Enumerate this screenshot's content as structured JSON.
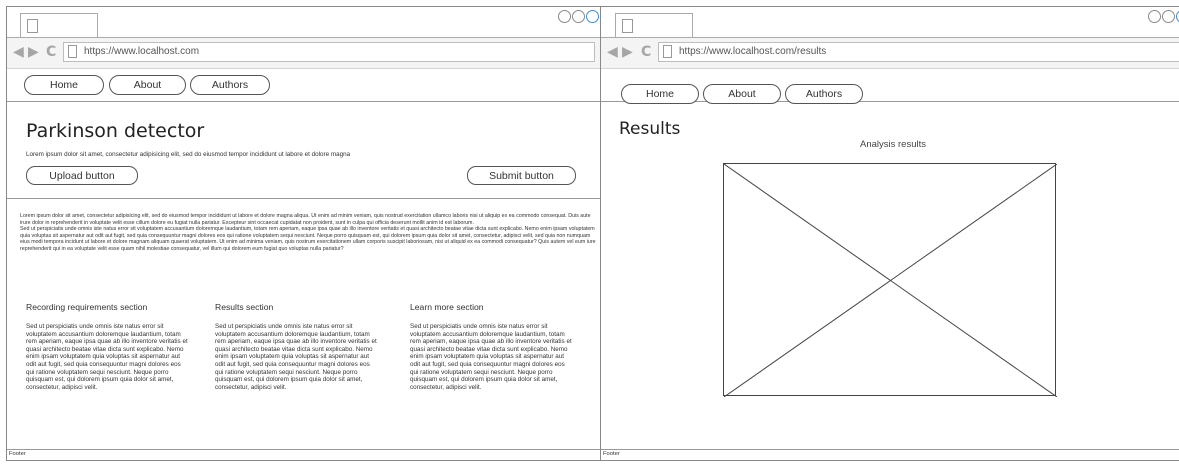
{
  "left_window": {
    "url": "https://www.localhost.com",
    "nav": {
      "home": "Home",
      "about": "About",
      "authors": "Authors"
    },
    "hero": {
      "title": "Parkinson detector",
      "description": "Lorem ipsum dolor sit amet, consectetur adipisicing elit, sed do eiusmod tempor incididunt ut labore et dolore magna",
      "upload_button": "Upload button",
      "submit_button": "Submit button"
    },
    "paragraph": {
      "part1": "Lorem ipsum dolor sit amet, consectetur adipisicing elit, sed do eiusmod tempor incididunt ut labore et dolore magna aliqua. Ut enim ad minim veniam, quis nostrud exercitation ullamco laboris nisi ut aliquip ex ea commodo consequat. Duis aute irure dolor in reprehenderit in voluptate velit esse cillum dolore eu fugiat nulla pariatur. Excepteur sint occaecat cupidatat non proident, sunt in culpa qui officia deserunt mollit anim id est laborum.",
      "part2": "Sed ut perspiciatis unde omnis iste natus error sit voluptatem accusantium doloremque laudantium, totam rem aperiam, eaque ipsa quae ab illo inventore veritatis et quasi architecto beatae vitae dicta sunt explicabo. Nemo enim ipsam voluptatem quia voluptas sit aspernatur aut odit aut fugit, sed quia consequuntur magni dolores eos qui ratione voluptatem sequi nesciunt. Neque porro quisquam est, qui dolorem ipsum quia dolor sit amet, consectetur, adipisci velit, sed quia non numquam eius modi tempora incidunt ut labore et dolore magnam aliquam quaerat voluptatem. Ut enim ad minima veniam, quis nostrum exercitationem ullam corporis suscipit laboriosam, nisi ut aliquid ex ea commodi consequatur? Quis autem vel eum iure reprehenderit qui in ea voluptate velit esse quam nihil molestiae consequatur, vel illum qui dolorem eum fugiat quo voluptas nulla pariatur?"
    },
    "sections": [
      {
        "heading": "Recording requirements section",
        "body": "Sed ut perspiciatis unde omnis iste natus error sit voluptatem accusantium doloremque laudantium, totam rem aperiam, eaque ipsa quae ab illo inventore veritatis et quasi architecto beatae vitae dicta sunt explicabo. Nemo enim ipsam voluptatem quia voluptas sit aspernatur aut odit aut fugit, sed quia consequuntur magni dolores eos qui ratione voluptatem sequi nesciunt. Neque porro quisquam est, qui dolorem ipsum quia dolor sit amet, consectetur, adipisci velit."
      },
      {
        "heading": "Results section",
        "body": "Sed ut perspiciatis unde omnis iste natus error sit voluptatem accusantium doloremque laudantium, totam rem aperiam, eaque ipsa quae ab illo inventore veritatis et quasi architecto beatae vitae dicta sunt explicabo. Nemo enim ipsam voluptatem quia voluptas sit aspernatur aut odit aut fugit, sed quia consequuntur magni dolores eos qui ratione voluptatem sequi nesciunt. Neque porro quisquam est, qui dolorem ipsum quia dolor sit amet, consectetur, adipisci velit."
      },
      {
        "heading": "Learn more section",
        "body": "Sed ut perspiciatis unde omnis iste natus error sit voluptatem accusantium doloremque laudantium, totam rem aperiam, eaque ipsa quae ab illo inventore veritatis et quasi architecto beatae vitae dicta sunt explicabo. Nemo enim ipsam voluptatem quia voluptas sit aspernatur aut odit aut fugit, sed quia consequuntur magni dolores eos qui ratione voluptatem sequi nesciunt. Neque porro quisquam est, qui dolorem ipsum quia dolor sit amet, consectetur, adipisci velit."
      }
    ],
    "footer": "Footer"
  },
  "right_window": {
    "url": "https://www.localhost.com/results",
    "nav": {
      "home": "Home",
      "about": "About",
      "authors": "Authors"
    },
    "title": "Results",
    "subtitle": "Analysis results",
    "footer": "Footer"
  },
  "icons": {
    "back": "arrow-left",
    "forward": "arrow-right",
    "reload": "reload",
    "page": "blank-page",
    "window_controls": "circles"
  },
  "colors": {
    "active_control": "#3d8fd6",
    "chrome_gray": "#a6a6a6"
  }
}
